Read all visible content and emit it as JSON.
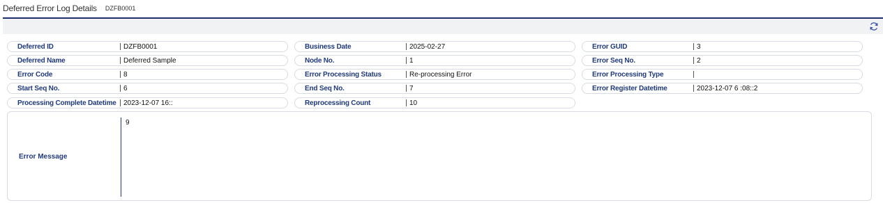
{
  "header": {
    "title": "Deferred Error Log Details",
    "subtitle": "DZFB0001"
  },
  "toolbar": {
    "refresh_icon": "refresh-icon"
  },
  "fields": [
    {
      "label": "Deferred ID",
      "value": "DZFB0001"
    },
    {
      "label": "Business Date",
      "value": "2025-02-27"
    },
    {
      "label": "Error GUID",
      "value": "3"
    },
    {
      "label": "Deferred Name",
      "value": "Deferred Sample"
    },
    {
      "label": "Node No.",
      "value": "1"
    },
    {
      "label": "Error Seq No.",
      "value": "2"
    },
    {
      "label": "Error Code",
      "value": "8"
    },
    {
      "label": "Error Processing Status",
      "value": "Re-processing Error"
    },
    {
      "label": "Error Processing Type",
      "value": ""
    },
    {
      "label": "Start Seq No.",
      "value": "6"
    },
    {
      "label": "End Seq No.",
      "value": "7"
    },
    {
      "label": "Error Register Datetime",
      "value": "2023-12-07 6 :08::2"
    },
    {
      "label": "Processing Complete Datetime",
      "value": "2023-12-07 16::"
    },
    {
      "label": "Reprocessing Count",
      "value": "10"
    }
  ],
  "error_message": {
    "label": "Error Message",
    "value": "9"
  }
}
